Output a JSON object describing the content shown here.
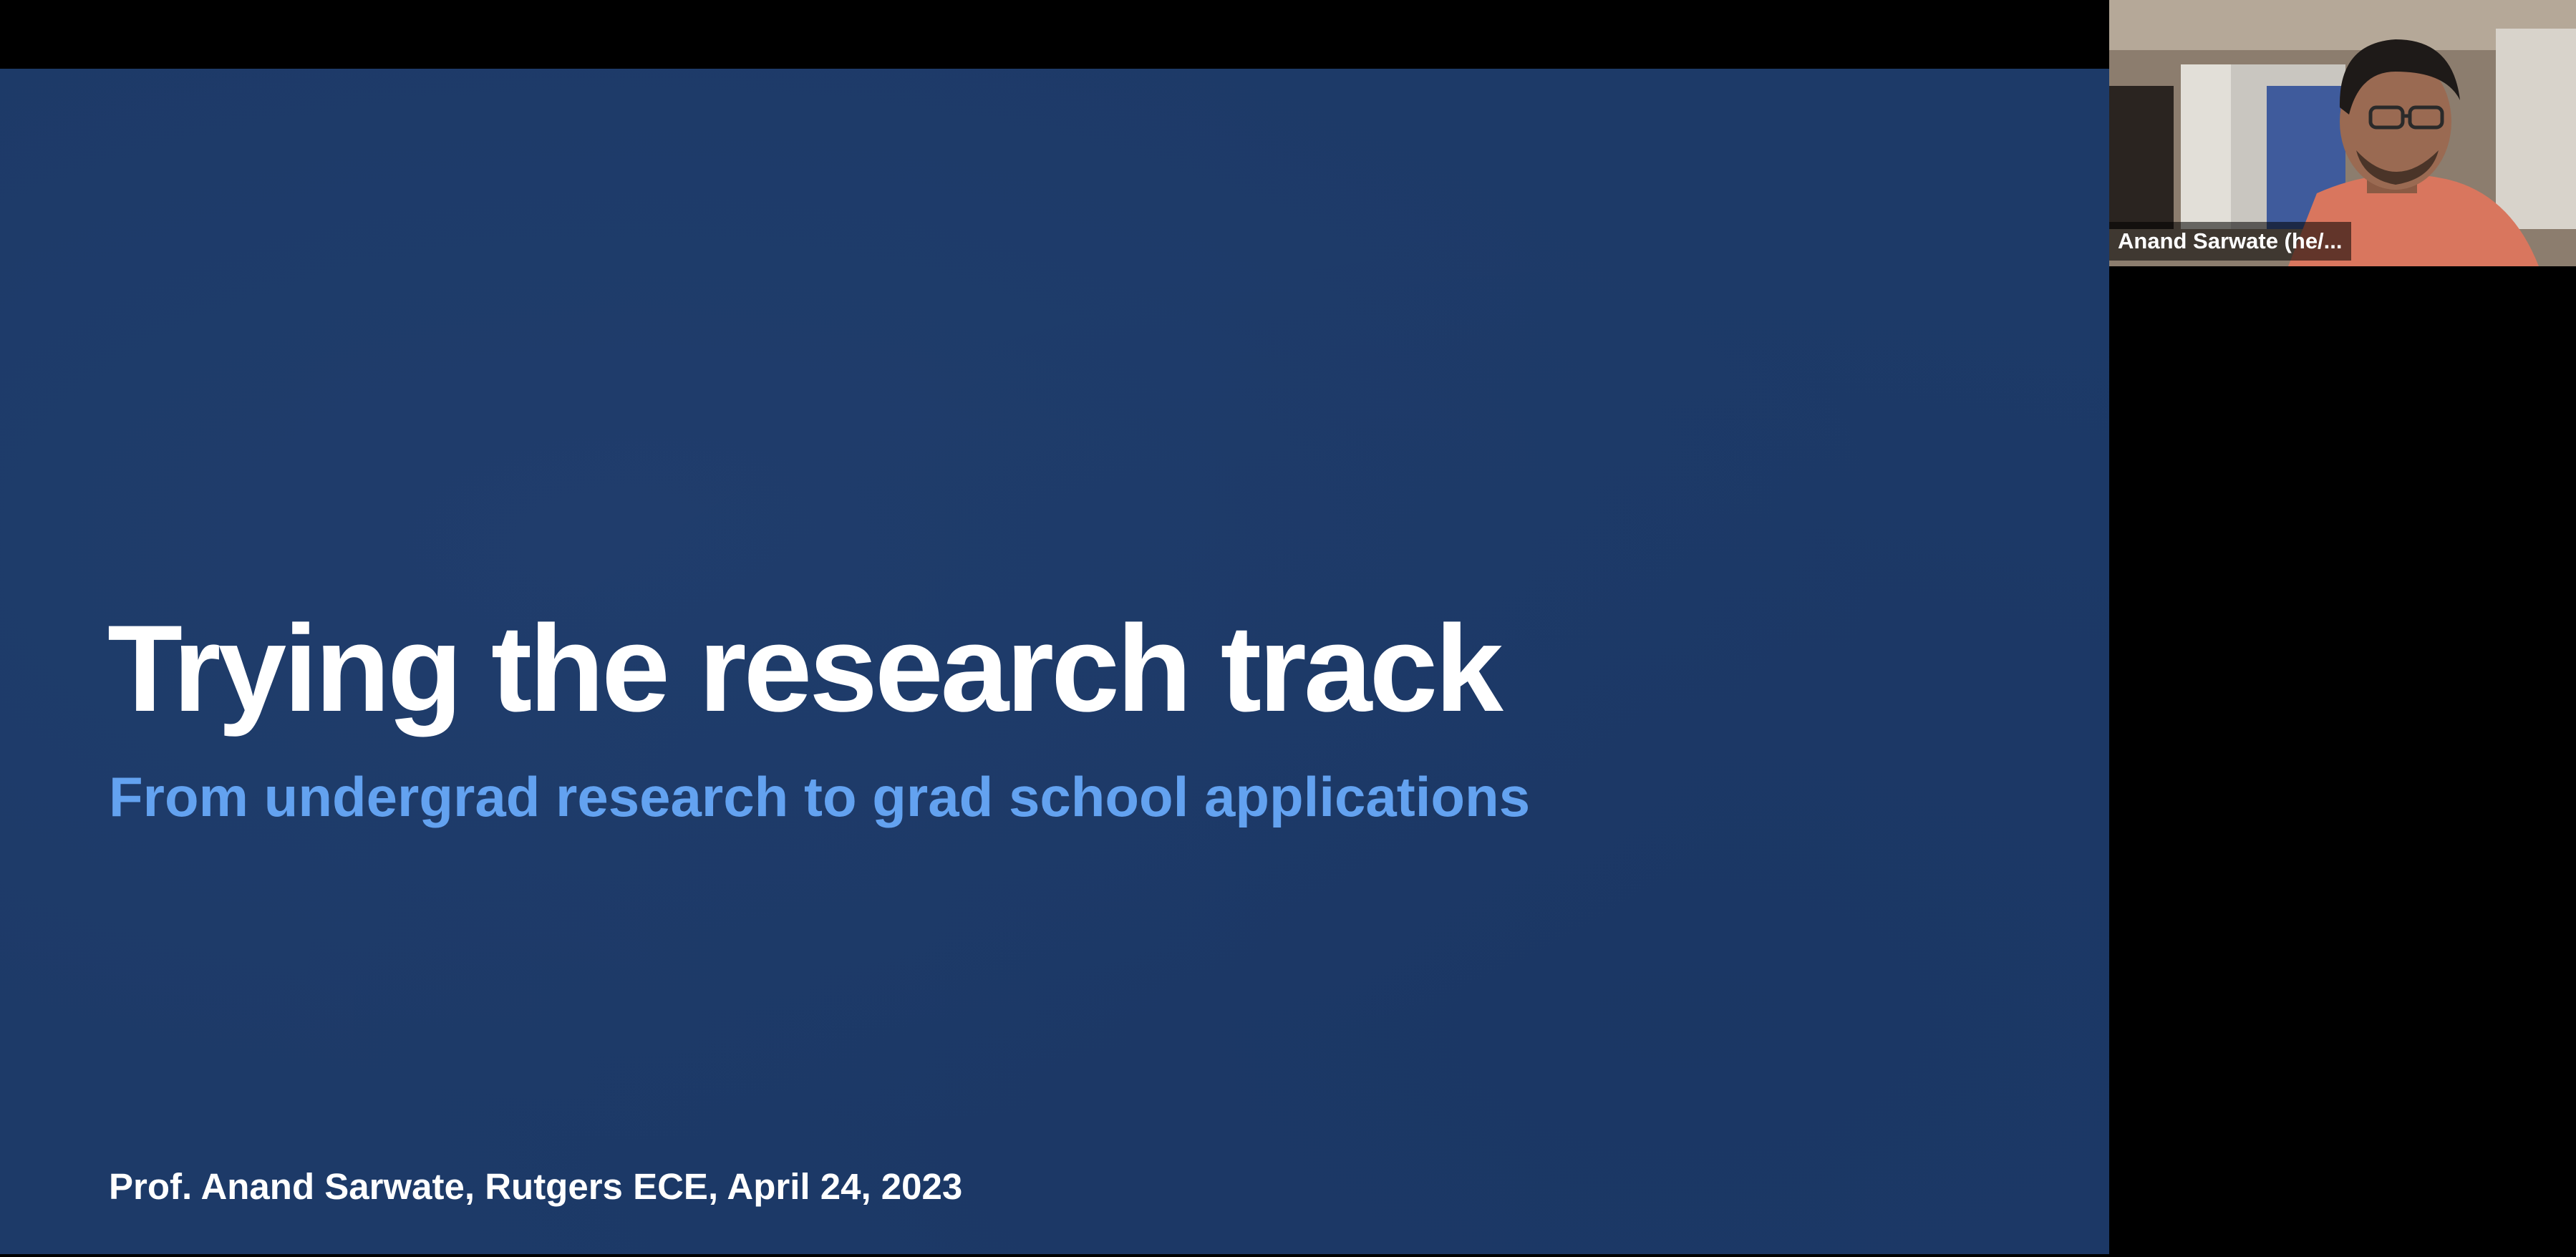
{
  "slide": {
    "title": "Trying the research track",
    "subtitle": "From undergrad research to grad school applications",
    "footer": "Prof. Anand Sarwate, Rutgers ECE, April 24, 2023"
  },
  "participant": {
    "name": "Anand Sarwate (he/..."
  },
  "colors": {
    "slide_background": "#1d3a68",
    "title_text": "#ffffff",
    "subtitle_text": "#63a2f0",
    "app_background": "#000000"
  }
}
